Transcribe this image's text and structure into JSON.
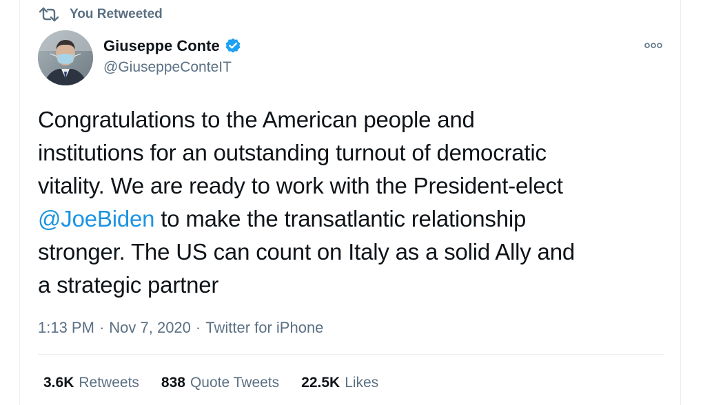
{
  "retweet_header": {
    "label": "You Retweeted",
    "icon": "retweet-icon"
  },
  "author": {
    "display_name": "Giuseppe Conte",
    "handle": "@GiuseppeConteIT",
    "verified": true,
    "verified_icon": "verified-badge-icon",
    "avatar_icon": "avatar-photo"
  },
  "more_menu": {
    "icon": "more-options-icon"
  },
  "tweet": {
    "lines": [
      "Congratulations to the American people and",
      "institutions for an outstanding turnout of democratic",
      "vitality. We are ready to work with the President-elect",
      {
        "mention": "@JoeBiden",
        "rest": " to make the transatlantic relationship"
      },
      "stronger. The US can count on Italy as a solid Ally and",
      "a strategic partner"
    ]
  },
  "meta": {
    "time": "1:13 PM",
    "date": "Nov 7, 2020",
    "source": "Twitter for iPhone",
    "separator": "·"
  },
  "stats": {
    "retweets": {
      "count": "3.6K",
      "label": "Retweets"
    },
    "quote_tweets": {
      "count": "838",
      "label": "Quote Tweets"
    },
    "likes": {
      "count": "22.5K",
      "label": "Likes"
    }
  },
  "colors": {
    "text": "#0f1419",
    "secondary": "#5b7083",
    "link": "#1b95e0",
    "verified": "#1da1f2",
    "divider": "#ebeef0"
  }
}
